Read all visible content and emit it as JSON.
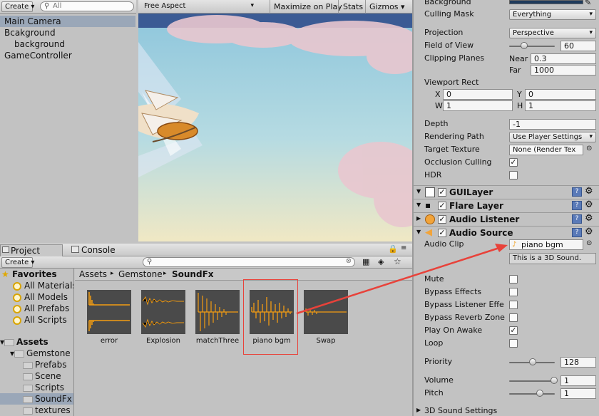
{
  "hierarchy": {
    "create_label": "Create",
    "search_placeholder": "All",
    "items": [
      {
        "label": "Main Camera",
        "selected": true
      },
      {
        "label": "Bcakground"
      },
      {
        "label": "background"
      },
      {
        "label": "GameController"
      }
    ]
  },
  "game_view": {
    "aspect": "Free Aspect",
    "maximize": "Maximize on Play",
    "stats": "Stats",
    "gizmos": "Gizmos"
  },
  "project": {
    "tab_project": "Project",
    "tab_console": "Console",
    "create_label": "Create",
    "favorites_label": "Favorites",
    "favorites": [
      "All Materials",
      "All Models",
      "All Prefabs",
      "All Scripts"
    ],
    "assets_label": "Assets",
    "tree": [
      {
        "label": "Gemstone"
      },
      {
        "label": "Prefabs"
      },
      {
        "label": "Scene"
      },
      {
        "label": "Scripts"
      },
      {
        "label": "SoundFx",
        "selected": true
      },
      {
        "label": "textures"
      }
    ],
    "breadcrumb": [
      "Assets",
      "Gemstone",
      "SoundFx"
    ],
    "assets": [
      {
        "name": "error"
      },
      {
        "name": "Explosion"
      },
      {
        "name": "matchThree"
      },
      {
        "name": "piano bgm",
        "highlighted": true
      },
      {
        "name": "Swap"
      }
    ]
  },
  "inspector": {
    "background_label": "Background",
    "culling_mask": {
      "label": "Culling Mask",
      "value": "Everything"
    },
    "projection": {
      "label": "Projection",
      "value": "Perspective"
    },
    "fov": {
      "label": "Field of View",
      "value": "60",
      "slider": 0.33
    },
    "clipping": {
      "label": "Clipping Planes",
      "near_label": "Near",
      "near": "0.3",
      "far_label": "Far",
      "far": "1000"
    },
    "viewport": {
      "label": "Viewport Rect",
      "x_label": "X",
      "x": "0",
      "y_label": "Y",
      "y": "0",
      "w_label": "W",
      "w": "1",
      "h_label": "H",
      "h": "1"
    },
    "depth": {
      "label": "Depth",
      "value": "-1"
    },
    "rendering_path": {
      "label": "Rendering Path",
      "value": "Use Player Settings"
    },
    "target_texture": {
      "label": "Target Texture",
      "value": "None (Render Tex"
    },
    "occlusion": {
      "label": "Occlusion Culling",
      "checked": true
    },
    "hdr": {
      "label": "HDR",
      "checked": false
    },
    "components": [
      {
        "name": "GUILayer",
        "enabled": true
      },
      {
        "name": "Flare Layer",
        "enabled": true
      },
      {
        "name": "Audio Listener",
        "enabled": true
      },
      {
        "name": "Audio Source",
        "enabled": true
      }
    ],
    "audio_clip": {
      "label": "Audio Clip",
      "value": "piano bgm",
      "note": "This is a 3D Sound."
    },
    "mute": {
      "label": "Mute",
      "checked": false
    },
    "bypass_effects": {
      "label": "Bypass Effects",
      "checked": false
    },
    "bypass_listener": {
      "label": "Bypass Listener Effe",
      "checked": false
    },
    "bypass_reverb": {
      "label": "Bypass Reverb Zone",
      "checked": false
    },
    "play_on_awake": {
      "label": "Play On Awake",
      "checked": true
    },
    "loop": {
      "label": "Loop",
      "checked": false
    },
    "priority": {
      "label": "Priority",
      "value": "128",
      "slider": 0.5
    },
    "volume": {
      "label": "Volume",
      "value": "1",
      "slider": 1.0
    },
    "pitch": {
      "label": "Pitch",
      "value": "1",
      "slider": 0.65
    },
    "sound_3d": {
      "label": "3D Sound Settings"
    }
  },
  "colors": {
    "accent_selected": "#9aa7b8",
    "arrow_red": "#e8423a",
    "waveform": "#f39c12",
    "sky_top": "#9ccde0",
    "header_blue": "#3b5b94"
  }
}
